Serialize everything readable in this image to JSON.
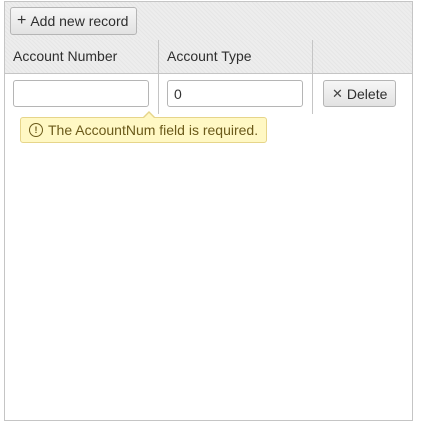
{
  "toolbar": {
    "add_label": "Add new record"
  },
  "columns": {
    "account_number": "Account Number",
    "account_type": "Account Type"
  },
  "row": {
    "account_number_value": "",
    "account_type_value": "0",
    "delete_label": "Delete"
  },
  "validation": {
    "message": "The AccountNum field is required."
  },
  "icons": {
    "add": "plus-icon",
    "delete": "close-icon",
    "warning": "exclamation-circle-icon"
  }
}
